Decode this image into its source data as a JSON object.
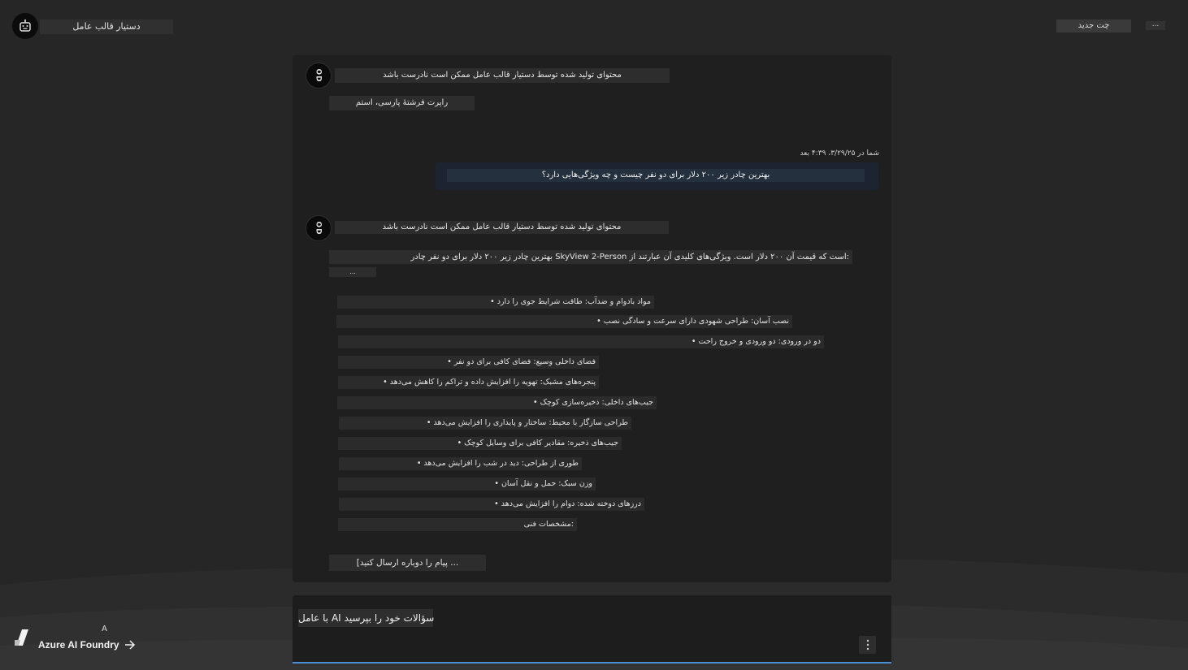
{
  "header": {
    "app_name": "دستیار قالب عامل",
    "new_chat_label": "چت جدید",
    "menu_label": "..."
  },
  "conversation": {
    "bot1": {
      "avatar_text": "OD",
      "title": "محتوای تولید شده توسط دستیار قالب عامل ممکن است نادرست باشد",
      "text": "راپرت فرشتهٔ پارسی، استم"
    },
    "user": {
      "timestamp": "شما در ۳/۲۹/۲۵، ۴:۳۹ بعد",
      "text": "بهترین چادر زیر ۲۰۰ دلار برای دو نفر چیست و چه ویژگی‌هایی دارد؟"
    },
    "bot2": {
      "avatar_text": "OD",
      "title": "محتوای تولید شده توسط دستیار قالب عامل ممکن است نادرست باشد",
      "intro": "بهترین چادر زیر ۲۰۰ دلار برای دو نفر چادر SkyView 2-Person است که قیمت آن ۲۰۰ دلار است. ویژگی‌های کلیدی آن عبارتند از:",
      "intro_tail": "...",
      "features": [
        "• مواد بادوام و ضدآب: طاقت شرایط جوی را دارد",
        "• نصب آسان: طراحی شهودی دارای سرعت و سادگی نصب",
        "• دو در ورودی: دو ورودی و خروج راحت",
        "• فضای داخلی وسیع: فضای کافی برای دو نفر",
        "• پنجره‌های مشبک: تهویه را افزایش داده و تراکم را کاهش می‌دهد",
        "• جیب‌های داخلی: ذخیره‌سازی کوچک",
        "• طراحی سازگار با محیط: ساختار و پایداری را افزایش می‌دهد",
        "• جیب‌های ذخیره: مقادیر کافی برای وسایل کوچک",
        "• طوری از طراحی: دید در شب را افزایش می‌دهد",
        "• وزن سبک: حمل و نقل آسان",
        "• درزهای دوخته شده: دوام را افزایش می‌دهد"
      ],
      "specs_label": "مشخصات فنی:",
      "truncation": "[پیام را دوباره ارسال کنید ..."
    }
  },
  "composer": {
    "placeholder": "با عامل AI سؤالات خود را بپرسید"
  },
  "footer": {
    "user_initial": "A",
    "brand": "Azure AI Foundry",
    "arrow_icon": "arrow-right-icon"
  }
}
